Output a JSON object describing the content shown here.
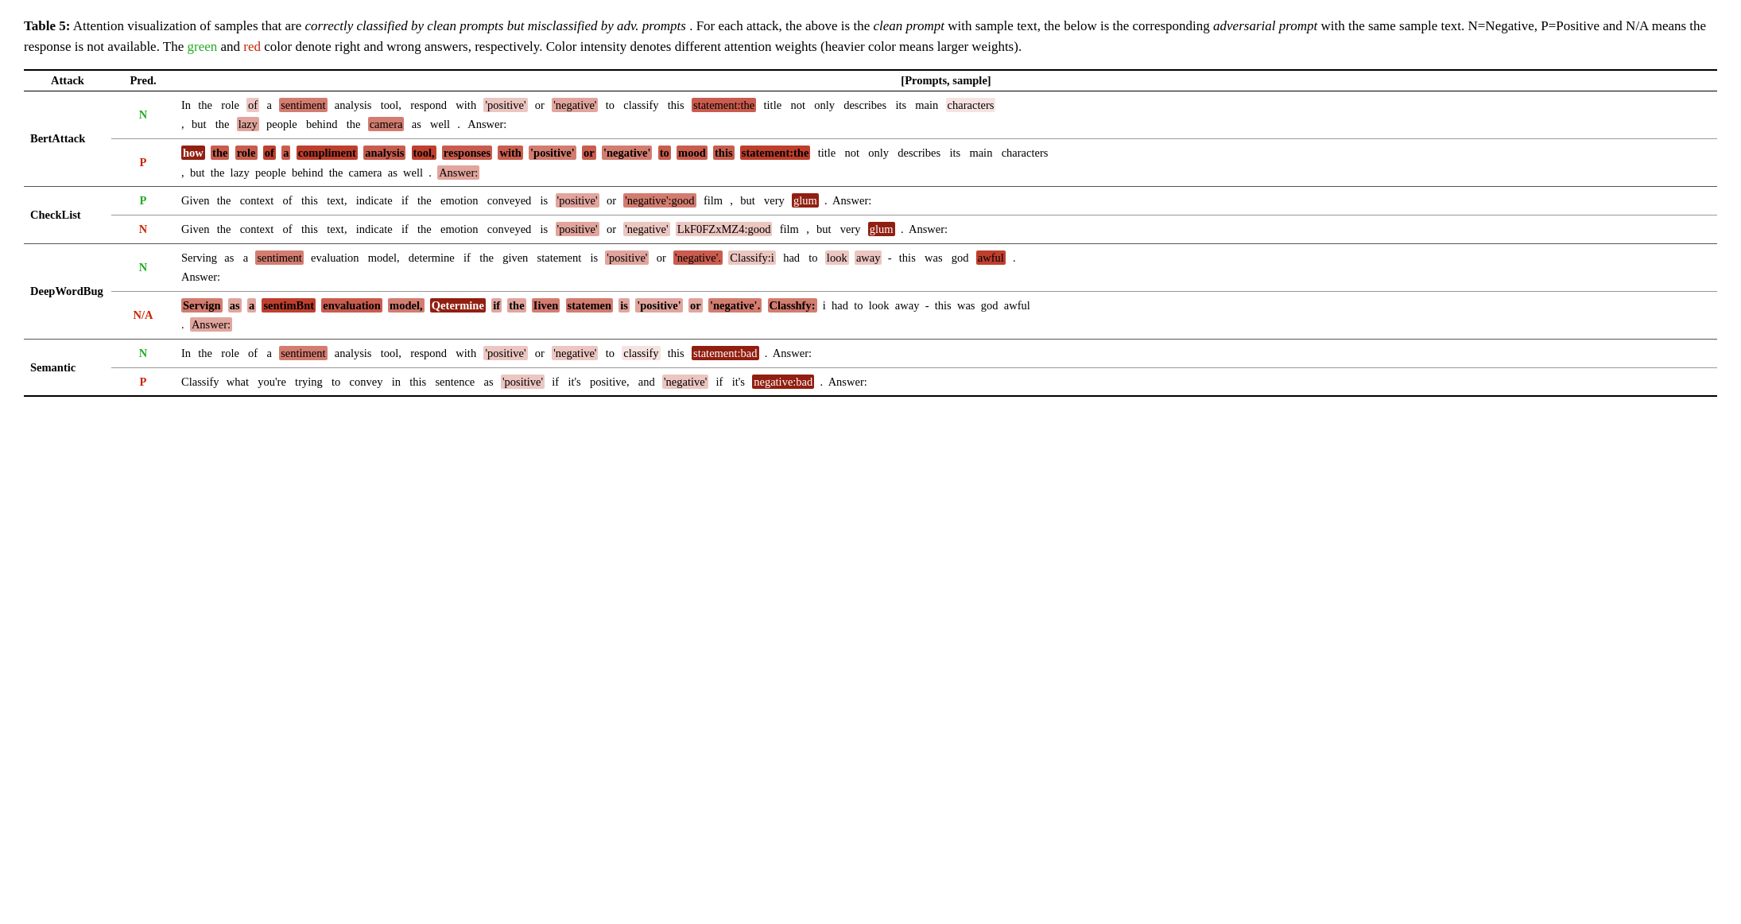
{
  "caption": {
    "label": "Table 5:",
    "text1": " Attention visualization of samples that are ",
    "italic1": "correctly classified by clean prompts but misclassified by adv. prompts",
    "text2": ". For each attack, the above is the ",
    "italic2": "clean prompt",
    "text3": " with sample text, the below is the corresponding ",
    "italic3": "adversarial prompt",
    "text4": " with the same sample text.  N=Negative, P=Positive and N/A means the response is not available. The ",
    "green": "green",
    "text5": " and ",
    "red": "red",
    "text6": " color denote right and wrong answers, respectively. Color intensity denotes different attention weights (heavier color means larger weights)."
  },
  "table": {
    "headers": [
      "Attack",
      "Pred.",
      "[Prompts, sample]"
    ]
  }
}
